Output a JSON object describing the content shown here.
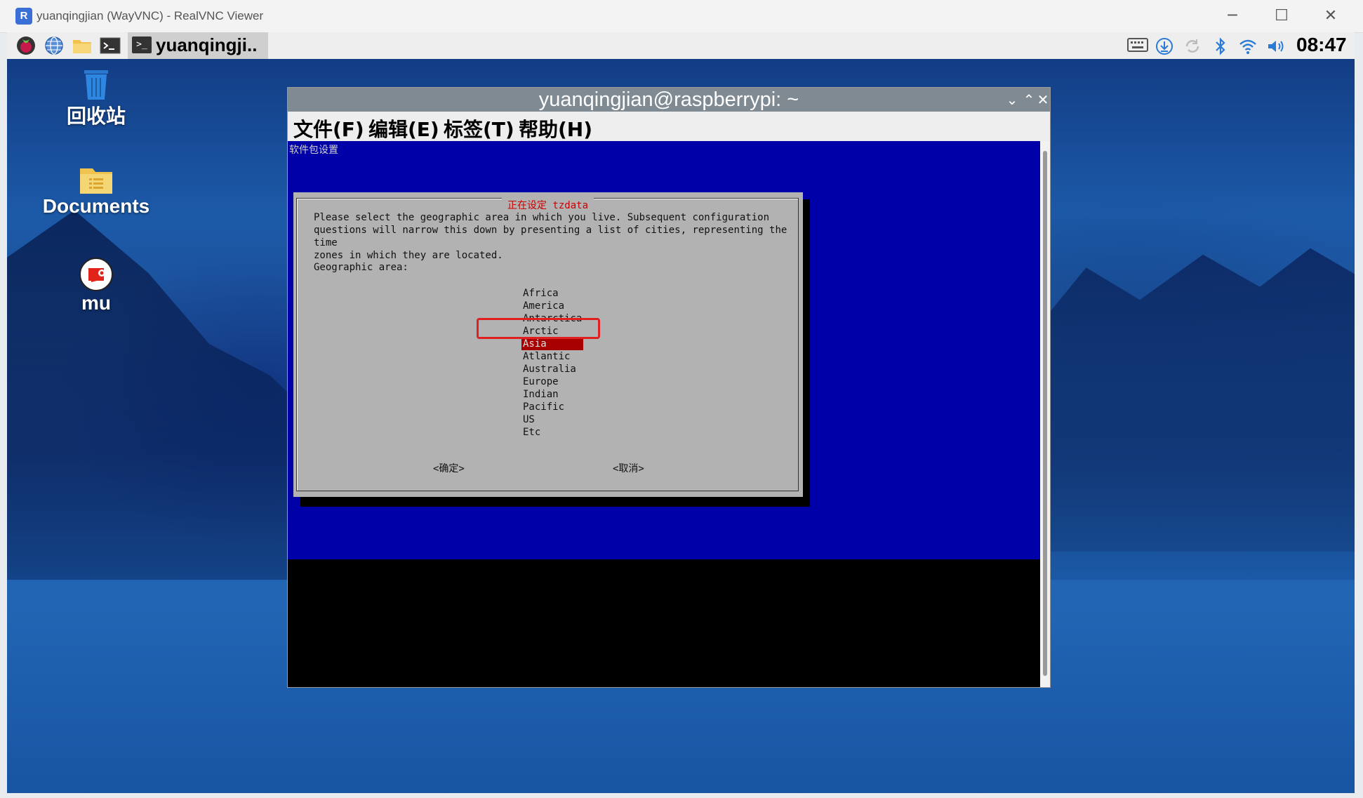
{
  "viewer": {
    "title": "yuanqingjian (WayVNC) - RealVNC Viewer",
    "logo_text": "R",
    "controls": [
      "─",
      "☐",
      "✕"
    ]
  },
  "panel": {
    "launchers": [
      "raspberry-icon",
      "globe-icon",
      "folder-icon",
      "terminal-icon"
    ],
    "task_label": "yuanqingji..",
    "task_icon": ">_",
    "tray": [
      "keyboard-icon",
      "download-icon",
      "sync-icon",
      "bluetooth-icon",
      "wifi-icon",
      "volume-icon"
    ],
    "clock": "08:47"
  },
  "desktop": {
    "items": [
      {
        "label": "回收站",
        "icon": "trash-icon"
      },
      {
        "label": "Documents",
        "icon": "folder-icon"
      },
      {
        "label": "mu",
        "icon": "mu-icon"
      }
    ]
  },
  "terminal": {
    "title": "yuanqingjian@raspberrypi: ~",
    "menu": [
      "文件(F)",
      "编辑(E)",
      "标签(T)",
      "帮助(H)"
    ],
    "header": "软件包设置",
    "dialog": {
      "title": "正在设定 tzdata",
      "text": "Please select the geographic area in which you live. Subsequent configuration\nquestions will narrow this down by presenting a list of cities, representing the time\nzones in which they are located.",
      "label": "Geographic area:",
      "areas": [
        "Africa",
        "America",
        "Antarctica",
        "Arctic",
        "Asia",
        "Atlantic",
        "Australia",
        "Europe",
        "Indian",
        "Pacific",
        "US",
        "Etc"
      ],
      "selected": "Asia",
      "ok": "<确定>",
      "cancel": "<取消>"
    }
  },
  "colors": {
    "dialog_blue": "#0000a8",
    "selection_red": "#a80000",
    "annotation_red": "#e02020"
  }
}
